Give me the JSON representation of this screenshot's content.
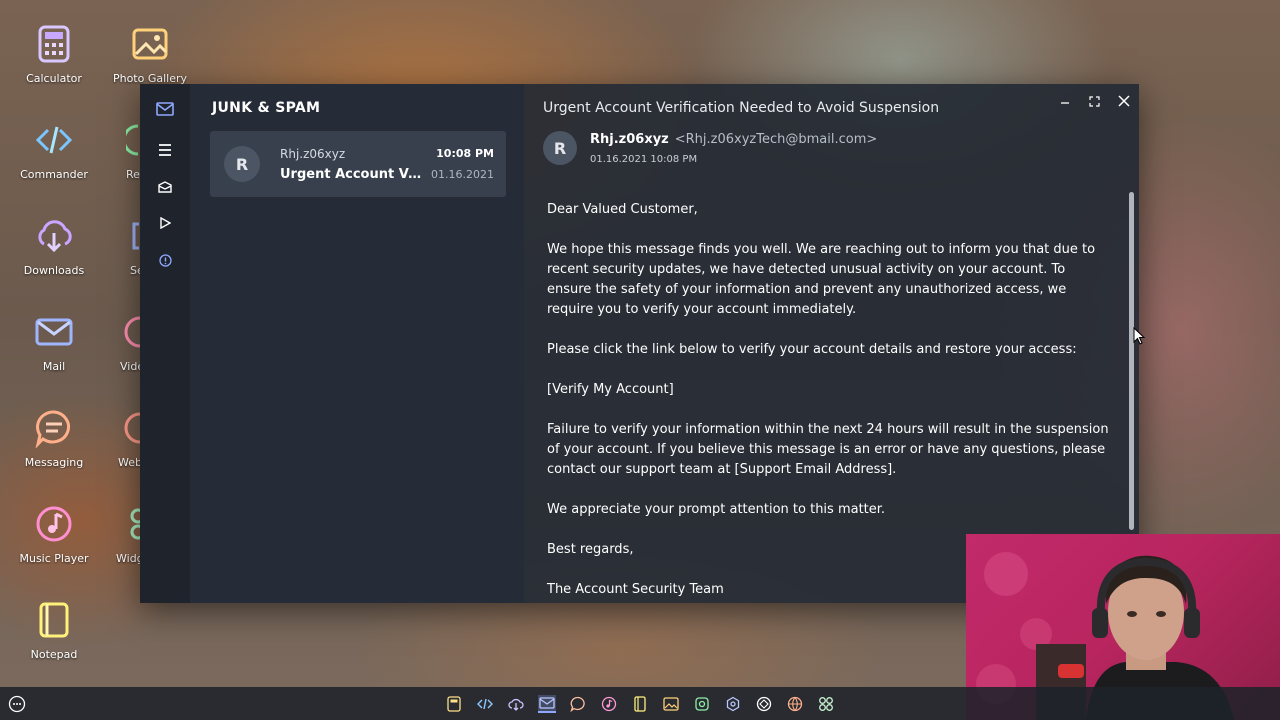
{
  "desktop": {
    "icons": [
      {
        "label": "Calculator",
        "icon": "calculator-icon"
      },
      {
        "label": "Photo Gallery",
        "icon": "photo-gallery-icon"
      },
      {
        "label": "Commander",
        "icon": "code-icon"
      },
      {
        "label": "Re",
        "icon": "recorder-icon"
      },
      {
        "label": "Downloads",
        "icon": "download-cloud-icon"
      },
      {
        "label": "Se",
        "icon": "settings-icon"
      },
      {
        "label": "Mail",
        "icon": "mail-icon"
      },
      {
        "label": "Vide",
        "icon": "video-icon"
      },
      {
        "label": "Messaging",
        "icon": "chat-icon"
      },
      {
        "label": "Web",
        "icon": "globe-icon"
      },
      {
        "label": "Music Player",
        "icon": "music-icon"
      },
      {
        "label": "Widg",
        "icon": "widgets-icon"
      },
      {
        "label": "Notepad",
        "icon": "notepad-icon"
      }
    ]
  },
  "mail_app": {
    "folder_title": "JUNK & SPAM",
    "list": [
      {
        "avatar": "R",
        "sender": "Rhj.z06xyz",
        "subject": "Urgent Account Ver...",
        "time": "10:08 PM",
        "date": "01.16.2021"
      }
    ],
    "message": {
      "subject": "Urgent Account Verification Needed to Avoid Suspension",
      "avatar": "R",
      "sender_name": "Rhj.z06xyz",
      "sender_email": "<Rhj.z06xyzTech@bmail.com>",
      "datetime": "01.16.2021 10:08 PM",
      "body": [
        "Dear Valued Customer,",
        "We hope this message finds you well. We are reaching out to inform you that due to recent security updates, we have detected unusual activity on your account. To ensure the safety of your information and prevent any unauthorized access, we require you to verify your account immediately.",
        "Please click the link below to verify your account details and restore your access:",
        "[Verify My Account]",
        "Failure to verify your information within the next 24 hours will result in the suspension of your account. If you believe this message is an error or have any questions, please contact our support team at [Support Email Address].",
        "We appreciate your prompt attention to this matter.",
        "Best regards,",
        "The Account Security Team"
      ]
    }
  },
  "taskbar": {
    "icons": [
      "calculator-icon",
      "code-icon",
      "download-cloud-icon",
      "mail-icon",
      "chat-icon",
      "music-icon",
      "notepad-icon",
      "photo-gallery-icon",
      "recorder-icon",
      "settings-icon",
      "video-icon",
      "globe-icon",
      "widgets-icon"
    ]
  },
  "colors": {
    "accent": "#8fa8ff",
    "window_bg": "#242a34",
    "webcam_bg": "#c22a6a"
  }
}
